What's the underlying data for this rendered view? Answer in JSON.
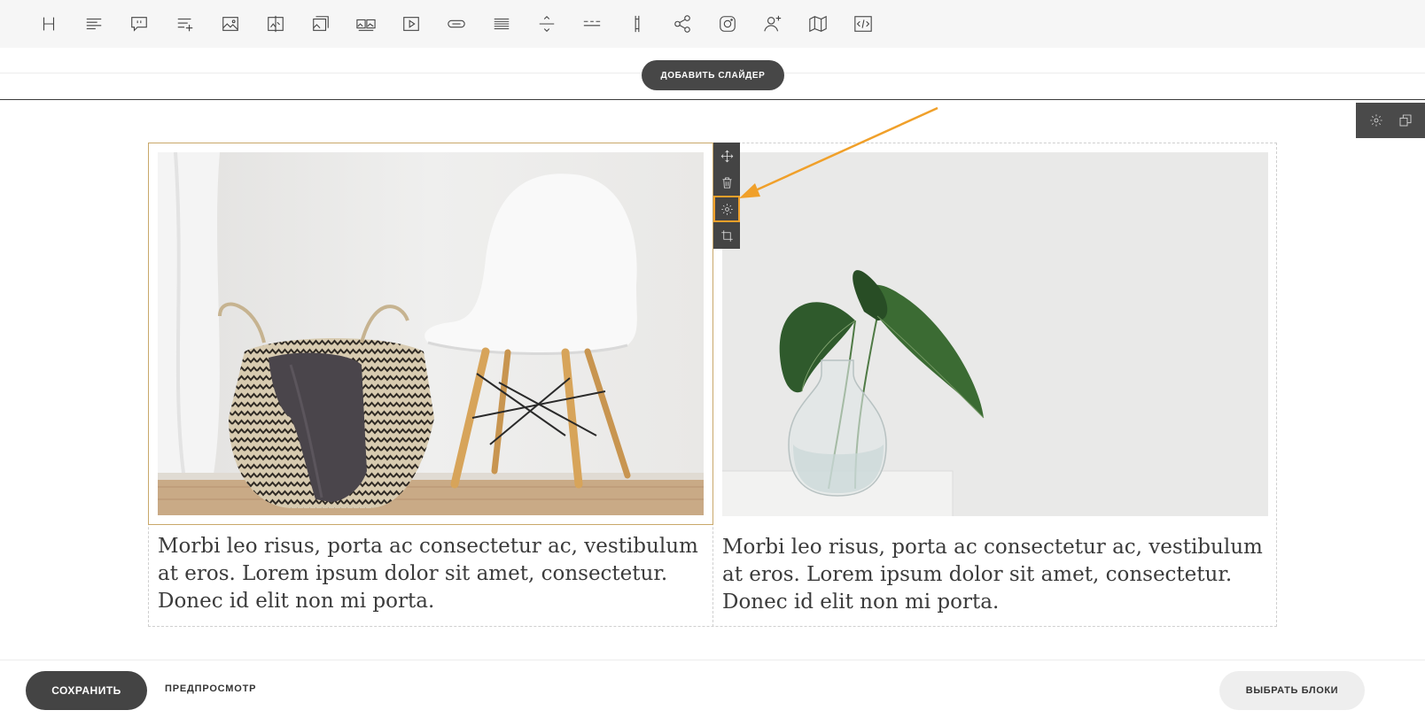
{
  "toolbar": {
    "tools": [
      {
        "icon": "heading-icon"
      },
      {
        "icon": "text-icon"
      },
      {
        "icon": "quote-icon"
      },
      {
        "icon": "list-add-icon"
      },
      {
        "icon": "image-icon"
      },
      {
        "icon": "image-compare-icon"
      },
      {
        "icon": "image-text-icon"
      },
      {
        "icon": "gallery-icon"
      },
      {
        "icon": "video-icon"
      },
      {
        "icon": "button-icon"
      },
      {
        "icon": "spacer-icon"
      },
      {
        "icon": "divider-icon"
      },
      {
        "icon": "dashed-line-icon"
      },
      {
        "icon": "column-icon"
      },
      {
        "icon": "share-icon"
      },
      {
        "icon": "instagram-icon"
      },
      {
        "icon": "add-user-icon"
      },
      {
        "icon": "map-icon"
      },
      {
        "icon": "code-icon"
      }
    ]
  },
  "slider": {
    "add_label": "ДОБАВИТЬ СЛАЙДЕР"
  },
  "block_tools": {
    "icons": [
      "gear-icon",
      "duplicate-icon"
    ]
  },
  "image_tools": {
    "icons": [
      "move-icon",
      "trash-icon",
      "gear-icon",
      "crop-icon"
    ],
    "highlighted": "gear-icon"
  },
  "columns": [
    {
      "image": "basket-and-chair-photo",
      "caption": "Morbi leo risus, porta ac consectetur ac, vestibulum at eros. Lorem ipsum dolor sit amet, consectetur. Donec id elit non mi porta."
    },
    {
      "image": "plant-in-vase-photo",
      "caption": "Morbi leo risus, porta ac consectetur ac, vestibulum at eros. Lorem ipsum dolor sit amet, consectetur. Donec id elit non mi porta."
    }
  ],
  "footer": {
    "save_label": "СОХРАНИТЬ",
    "preview_label": "ПРЕДПРОСМОТР",
    "choose_blocks_label": "ВЫБРАТЬ БЛОКИ"
  },
  "colors": {
    "accent": "#f0a02a",
    "dark_button": "#444444",
    "selection_border": "#c9a86a"
  }
}
